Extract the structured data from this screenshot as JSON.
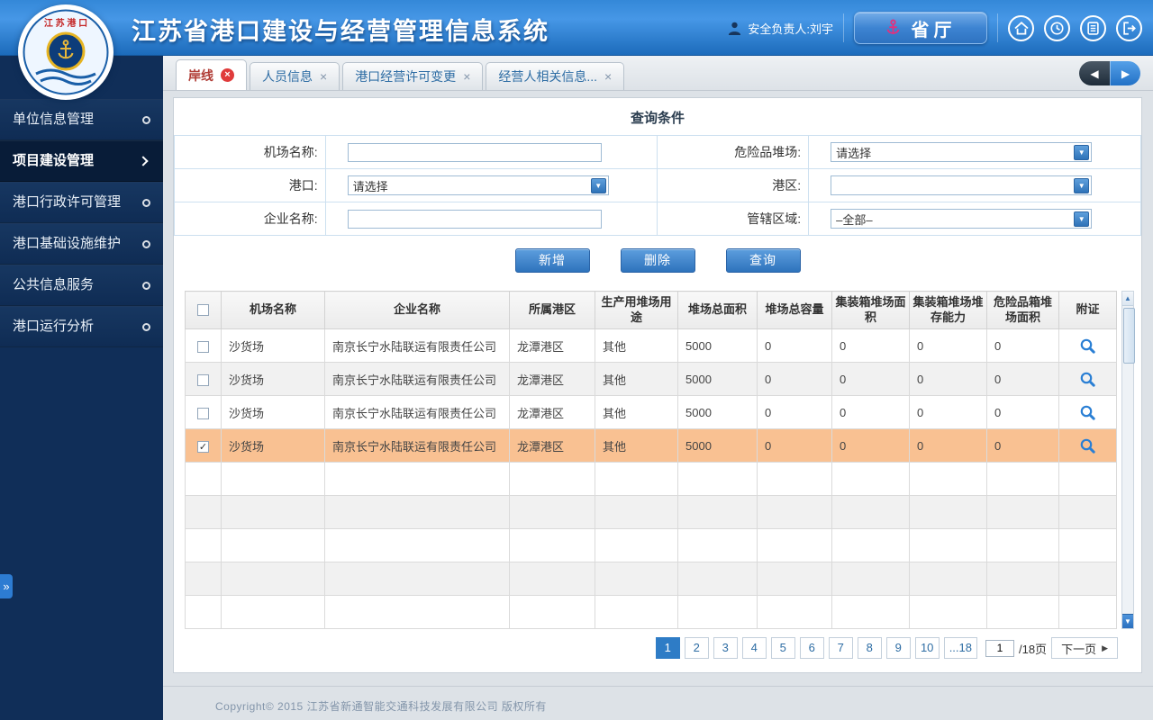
{
  "header": {
    "title": "江苏省港口建设与经营管理信息系统",
    "user_label": "安全负责人:刘宇",
    "dept_button_label": "省厅"
  },
  "sidebar": {
    "items": [
      {
        "label": "单位信息管理",
        "active": false
      },
      {
        "label": "项目建设管理",
        "active": true
      },
      {
        "label": "港口行政许可管理",
        "active": false
      },
      {
        "label": "港口基础设施维护",
        "active": false
      },
      {
        "label": "公共信息服务",
        "active": false
      },
      {
        "label": "港口运行分析",
        "active": false
      }
    ]
  },
  "tabs": [
    {
      "label": "岸线",
      "active": true
    },
    {
      "label": "人员信息",
      "active": false
    },
    {
      "label": "港口经营许可变更",
      "active": false
    },
    {
      "label": "经营人相关信息...",
      "active": false
    }
  ],
  "query": {
    "title": "查询条件",
    "fields": {
      "airport_name": {
        "label": "机场名称:",
        "value": ""
      },
      "dangerous_yard": {
        "label": "危险品堆场:",
        "value": "请选择"
      },
      "port": {
        "label": "港口:",
        "value": "请选择"
      },
      "port_area": {
        "label": "港区:",
        "value": ""
      },
      "enterprise_name": {
        "label": "企业名称:",
        "value": ""
      },
      "jurisdiction": {
        "label": "管辖区域:",
        "value": "–全部–"
      }
    }
  },
  "actions": {
    "add": "新增",
    "delete": "删除",
    "search": "查询"
  },
  "table": {
    "headers": [
      "机场名称",
      "企业名称",
      "所属港区",
      "生产用堆场用途",
      "堆场总面积",
      "堆场总容量",
      "集装箱堆场面积",
      "集装箱堆场堆存能力",
      "危险品箱堆场面积",
      "附证"
    ],
    "rows": [
      {
        "checked": false,
        "selected": false,
        "cells": [
          "沙货场",
          "南京长宁水陆联运有限责任公司",
          "龙潭港区",
          "其他",
          "5000",
          "0",
          "0",
          "0",
          "0"
        ]
      },
      {
        "checked": false,
        "selected": false,
        "cells": [
          "沙货场",
          "南京长宁水陆联运有限责任公司",
          "龙潭港区",
          "其他",
          "5000",
          "0",
          "0",
          "0",
          "0"
        ]
      },
      {
        "checked": false,
        "selected": false,
        "cells": [
          "沙货场",
          "南京长宁水陆联运有限责任公司",
          "龙潭港区",
          "其他",
          "5000",
          "0",
          "0",
          "0",
          "0"
        ]
      },
      {
        "checked": true,
        "selected": true,
        "cells": [
          "沙货场",
          "南京长宁水陆联运有限责任公司",
          "龙潭港区",
          "其他",
          "5000",
          "0",
          "0",
          "0",
          "0"
        ]
      }
    ],
    "empty_row_count": 5
  },
  "pagination": {
    "pages": [
      "1",
      "2",
      "3",
      "4",
      "5",
      "6",
      "7",
      "8",
      "9",
      "10",
      "...18"
    ],
    "active_page": "1",
    "page_input_value": "1",
    "total_label": "/18页",
    "next_label": "下一页"
  },
  "footer": {
    "copyright": "Copyright© 2015 江苏省新通智能交通科技发展有限公司 版权所有"
  },
  "colors": {
    "header_blue": "#2f7ecf",
    "sidebar_navy": "#102e58",
    "accent_blue": "#2e74bd",
    "selected_row_orange": "#f9c192",
    "active_tab_close_red": "#e03b3b"
  }
}
